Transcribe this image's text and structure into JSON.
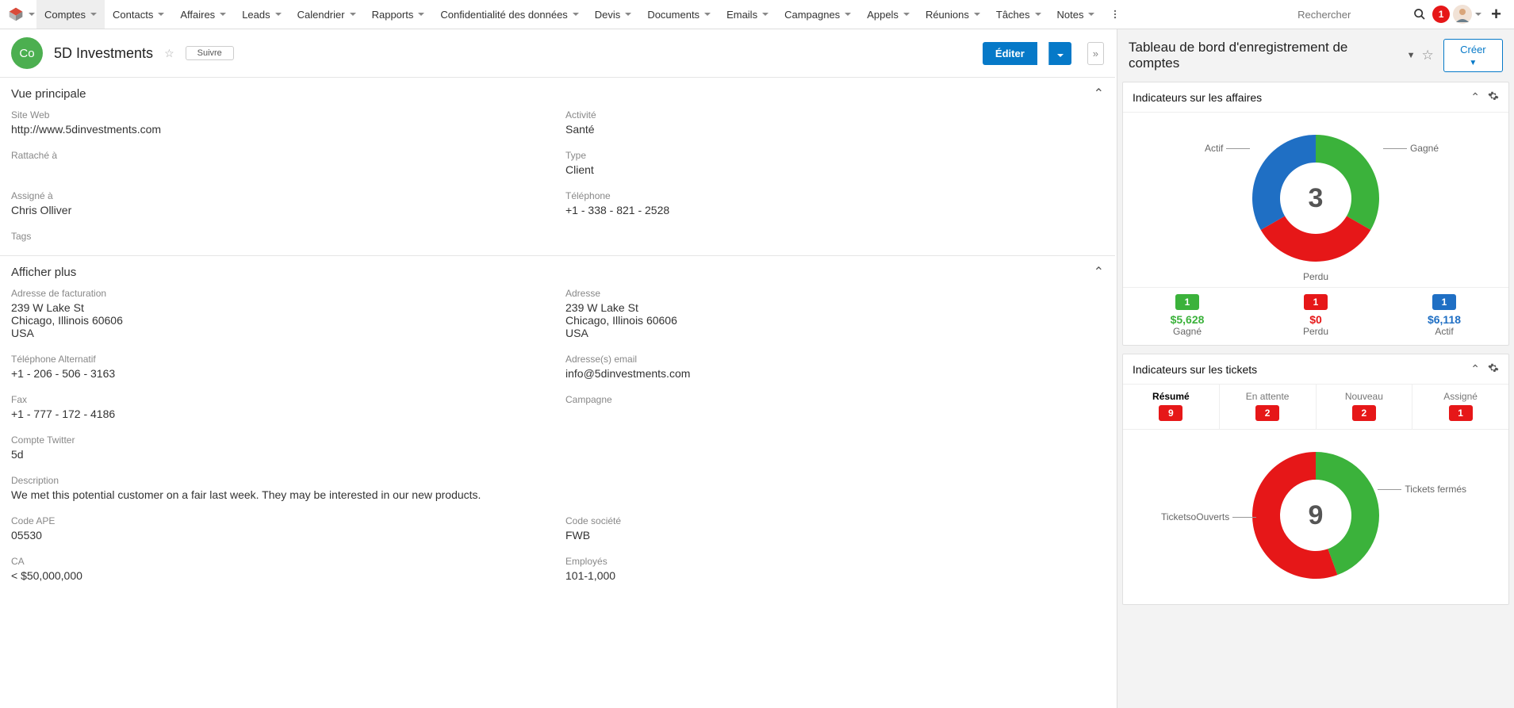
{
  "nav": {
    "items": [
      "Comptes",
      "Contacts",
      "Affaires",
      "Leads",
      "Calendrier",
      "Rapports",
      "Confidentialité des données",
      "Devis",
      "Documents",
      "Emails",
      "Campagnes",
      "Appels",
      "Réunions",
      "Tâches",
      "Notes"
    ],
    "active": 0,
    "search_placeholder": "Rechercher",
    "notification_count": "1"
  },
  "record": {
    "avatar": "Co",
    "title": "5D Investments",
    "follow_label": "Suivre",
    "edit_label": "Éditer"
  },
  "sections": {
    "main_title": "Vue principale",
    "more_title": "Afficher plus"
  },
  "fields": {
    "website_label": "Site Web",
    "website_value": "http://www.5dinvestments.com",
    "activity_label": "Activité",
    "activity_value": "Santé",
    "attached_label": "Rattaché à",
    "attached_value": "",
    "type_label": "Type",
    "type_value": "Client",
    "assigned_label": "Assigné à",
    "assigned_value": "Chris Olliver",
    "phone_label": "Téléphone",
    "phone_value": "+1 - 338 - 821 - 2528",
    "tags_label": "Tags",
    "tags_value": ""
  },
  "more": {
    "billing_label": "Adresse de facturation",
    "billing_line1": "239 W Lake St",
    "billing_line2": "Chicago,  Illinois   60606",
    "billing_line3": "USA",
    "address_label": "Adresse",
    "address_line1": "239 W Lake St",
    "address_line2": "Chicago,  Illinois   60606",
    "address_line3": "USA",
    "altphone_label": "Téléphone Alternatif",
    "altphone_value": "+1 - 206 - 506 - 3163",
    "emails_label": "Adresse(s) email",
    "emails_value": "info@5dinvestments.com",
    "fax_label": "Fax",
    "fax_value": "+1 - 777 - 172 - 4186",
    "campaign_label": "Campagne",
    "campaign_value": "",
    "twitter_label": "Compte Twitter",
    "twitter_value": "5d",
    "description_label": "Description",
    "description_value": "We met this potential customer on a fair last week. They may be interested in our new products.",
    "ape_label": "Code APE",
    "ape_value": "05530",
    "societe_label": "Code société",
    "societe_value": "FWB",
    "ca_label": "CA",
    "ca_value": "< $50,000,000",
    "employes_label": "Employés",
    "employes_value": "101-1,000"
  },
  "dashboard": {
    "title": "Tableau de bord d'enregistrement de comptes",
    "create_label": "Créer"
  },
  "deals": {
    "title": "Indicateurs sur les affaires",
    "center": "3",
    "legend": {
      "active": "Actif",
      "won": "Gagné",
      "lost": "Perdu"
    },
    "kpis": [
      {
        "count": "1",
        "amount": "$5,628",
        "label": "Gagné",
        "color": "green"
      },
      {
        "count": "1",
        "amount": "$0",
        "label": "Perdu",
        "color": "red"
      },
      {
        "count": "1",
        "amount": "$6,118",
        "label": "Actif",
        "color": "blue"
      }
    ]
  },
  "tickets": {
    "title": "Indicateurs sur les tickets",
    "tabs": [
      {
        "name": "Résumé",
        "count": "9",
        "active": true
      },
      {
        "name": "En attente",
        "count": "2"
      },
      {
        "name": "Nouveau",
        "count": "2"
      },
      {
        "name": "Assigné",
        "count": "1"
      }
    ],
    "center": "9",
    "legend": {
      "open": "TicketsoOuverts",
      "closed": "Tickets fermés"
    }
  },
  "chart_data": [
    {
      "type": "pie",
      "title": "Indicateurs sur les affaires",
      "series": [
        {
          "name": "Actif",
          "value": 1
        },
        {
          "name": "Gagné",
          "value": 1
        },
        {
          "name": "Perdu",
          "value": 1
        }
      ],
      "colors": {
        "Actif": "#1f6fc4",
        "Gagné": "#3bb23b",
        "Perdu": "#e61718"
      },
      "hole": 0.55,
      "center_text": "3"
    },
    {
      "type": "pie",
      "title": "Indicateurs sur les tickets",
      "series": [
        {
          "name": "TicketsoOuverts",
          "value": 5
        },
        {
          "name": "Tickets fermés",
          "value": 4
        }
      ],
      "colors": {
        "TicketsoOuverts": "#e61718",
        "Tickets fermés": "#3bb23b"
      },
      "hole": 0.55,
      "center_text": "9"
    }
  ]
}
